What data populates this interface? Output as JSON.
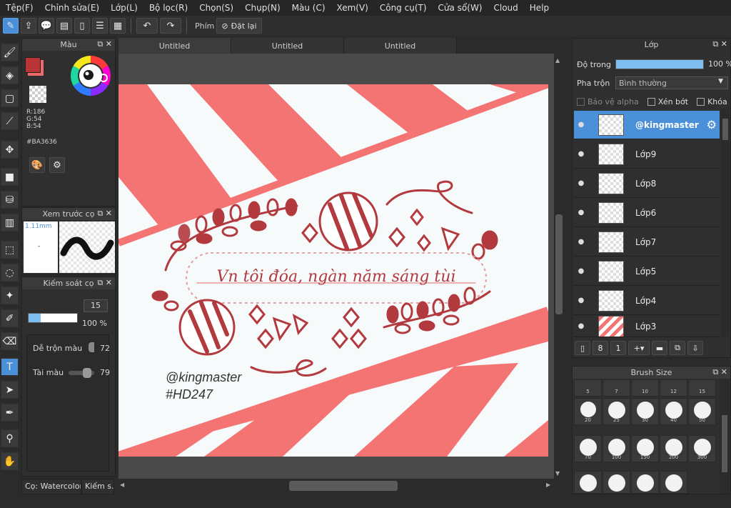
{
  "menu": [
    "Tệp(F)",
    "Chỉnh sửa(E)",
    "Lớp(L)",
    "Bộ lọc(R)",
    "Chọn(S)",
    "Chụp(N)",
    "Màu (C)",
    "Xem(V)",
    "Công cụ(T)",
    "Cửa sổ(W)",
    "Cloud",
    "Help"
  ],
  "toolbar": {
    "phim_label": "Phím",
    "reset_label": "Đặt lại"
  },
  "color_panel": {
    "title": "Màu",
    "r": "R:186",
    "g": "G:54",
    "b": "B:54",
    "hex": "#BA3636",
    "main_color": "#ba3636",
    "secondary_color": "#f06a6a"
  },
  "preview_panel": {
    "title": "Xem trước cọ",
    "size": "1.11mm",
    "dot": "-"
  },
  "brush_panel": {
    "title": "Kiếm soát cọ",
    "size_value": "15",
    "opacity_value": "100 %",
    "size_fraction": 0.25,
    "opacity_fraction": 1.0,
    "blend_label": "Dễ trộn màu",
    "blend_value": "72",
    "paint_label": "Tài màu",
    "paint_value": "79",
    "tab1": "Cọ: Watercolor ..",
    "tab2": "Kiếm s.."
  },
  "doc_tabs": [
    "Untitled",
    "Untitled",
    "Untitled"
  ],
  "artwork": {
    "script_text": "Vn tôi đóa, ngàn năm sáng tùi",
    "watermark1": "@kingmaster",
    "watermark2": "#HD247",
    "stripe_color": "#f47474",
    "ink_color": "#b23a3e",
    "bg_color": "#f6fafb"
  },
  "layer_panel": {
    "title": "Lớp",
    "opacity_label": "Độ trong",
    "opacity_value": "100 %",
    "opacity_fraction": 1.0,
    "blend_label": "Pha trộn",
    "blend_value": "Bình thường",
    "protect_alpha": "Bảo vệ alpha",
    "clip": "Xén bớt",
    "lock": "Khóa",
    "layers": [
      "@kingmaster",
      "Lớp9",
      "Lớp8",
      "Lớp6",
      "Lớp7",
      "Lớp5",
      "Lớp4",
      "Lớp3"
    ]
  },
  "brush_size_panel": {
    "title": "Brush Size",
    "row0": [
      "5",
      "7",
      "10",
      "12",
      "15"
    ],
    "row1": [
      "20",
      "25",
      "30",
      "40",
      "50"
    ],
    "row2": [
      "70",
      "100",
      "150",
      "200",
      "300"
    ]
  }
}
